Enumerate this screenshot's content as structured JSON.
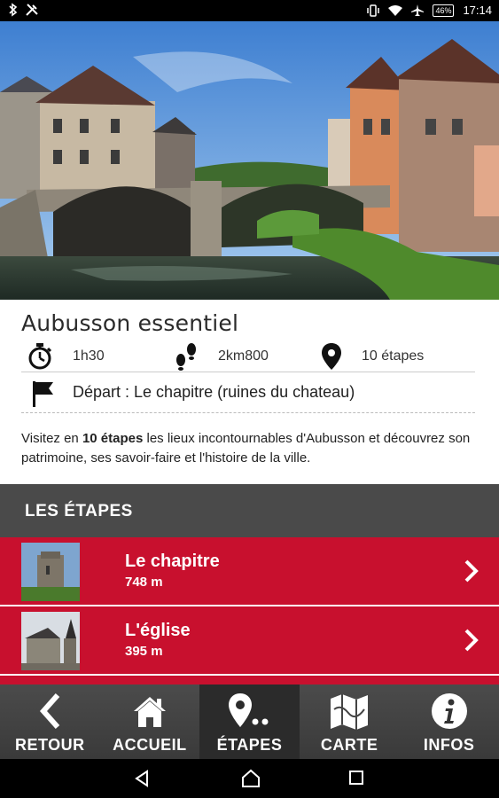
{
  "status": {
    "time": "17:14",
    "battery": "46%"
  },
  "route": {
    "title": "Aubusson essentiel",
    "duration": "1h30",
    "distance": "2km800",
    "steps_count": "10 étapes",
    "depart": "Départ : Le chapitre (ruines du chateau)",
    "description_prefix": "Visitez en ",
    "description_bold": "10 étapes",
    "description_suffix": " les lieux incontournables d'Aubusson et découvrez son patrimoine, ses savoir-faire et l'histoire de la ville."
  },
  "section": {
    "title": "LES ÉTAPES"
  },
  "steps": [
    {
      "name": "Le chapitre",
      "distance": "748 m"
    },
    {
      "name": "L'église",
      "distance": "395 m"
    }
  ],
  "tabs": [
    {
      "label": "RETOUR",
      "icon": "chevron-left-icon"
    },
    {
      "label": "ACCUEIL",
      "icon": "home-icon"
    },
    {
      "label": "ÉTAPES",
      "icon": "map-pin-icon"
    },
    {
      "label": "CARTE",
      "icon": "map-icon"
    },
    {
      "label": "INFOS",
      "icon": "info-icon"
    }
  ],
  "colors": {
    "accent": "#c8102e",
    "tabbar": "#444444",
    "section": "#4a4a4a"
  }
}
